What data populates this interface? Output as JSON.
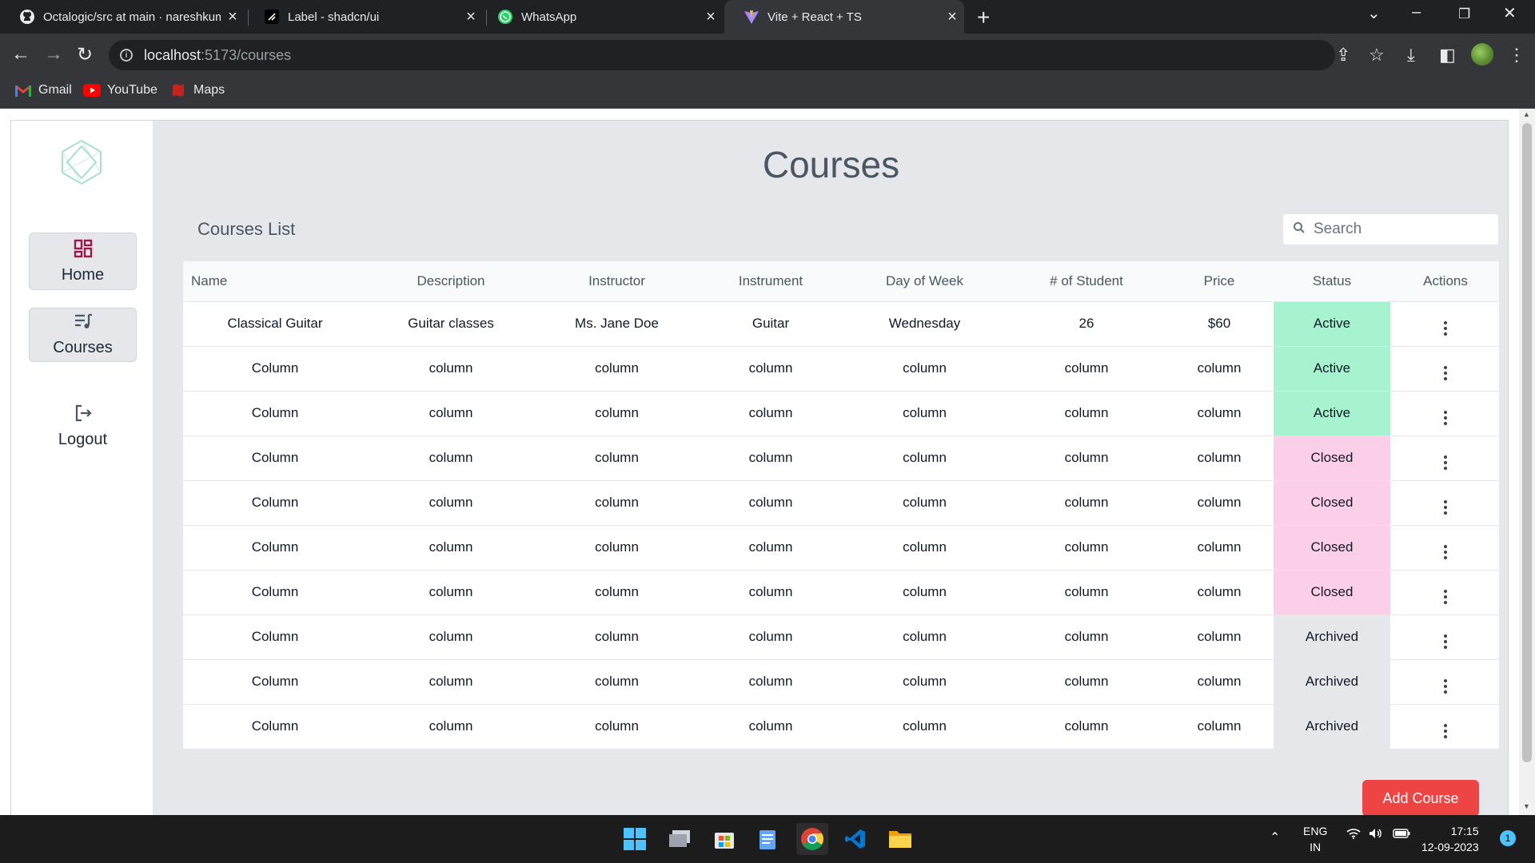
{
  "browser": {
    "tabs": [
      {
        "title": "Octalogic/src at main · nareshkum",
        "icon": "github-icon"
      },
      {
        "title": "Label - shadcn/ui",
        "icon": "shadcn-icon"
      },
      {
        "title": "WhatsApp",
        "icon": "whatsapp-icon"
      },
      {
        "title": "Vite + React + TS",
        "icon": "vite-icon",
        "active": true
      }
    ],
    "url_host": "localhost",
    "url_path": ":5173/courses",
    "bookmarks": [
      "Gmail",
      "YouTube",
      "Maps"
    ]
  },
  "sidebar": {
    "items": [
      {
        "label": "Home",
        "icon": "dashboard-icon",
        "color": "#9d174d"
      },
      {
        "label": "Courses",
        "icon": "playlist-icon"
      },
      {
        "label": "Logout",
        "icon": "logout-icon"
      }
    ]
  },
  "page": {
    "title": "Courses",
    "list_title": "Courses List",
    "search_placeholder": "Search"
  },
  "table": {
    "columns": [
      "Name",
      "Description",
      "Instructor",
      "Instrument",
      "Day of Week",
      "# of Student",
      "Price",
      "Status",
      "Actions"
    ],
    "rows": [
      {
        "name": "Classical Guitar",
        "description": "Guitar classes",
        "instructor": "Ms. Jane Doe",
        "instrument": "Guitar",
        "day": "Wednesday",
        "students": "26",
        "price": "$60",
        "status": "Active"
      },
      {
        "name": "Column",
        "description": "column",
        "instructor": "column",
        "instrument": "column",
        "day": "column",
        "students": "column",
        "price": "column",
        "status": "Active"
      },
      {
        "name": "Column",
        "description": "column",
        "instructor": "column",
        "instrument": "column",
        "day": "column",
        "students": "column",
        "price": "column",
        "status": "Active"
      },
      {
        "name": "Column",
        "description": "column",
        "instructor": "column",
        "instrument": "column",
        "day": "column",
        "students": "column",
        "price": "column",
        "status": "Closed"
      },
      {
        "name": "Column",
        "description": "column",
        "instructor": "column",
        "instrument": "column",
        "day": "column",
        "students": "column",
        "price": "column",
        "status": "Closed"
      },
      {
        "name": "Column",
        "description": "column",
        "instructor": "column",
        "instrument": "column",
        "day": "column",
        "students": "column",
        "price": "column",
        "status": "Closed"
      },
      {
        "name": "Column",
        "description": "column",
        "instructor": "column",
        "instrument": "column",
        "day": "column",
        "students": "column",
        "price": "column",
        "status": "Closed"
      },
      {
        "name": "Column",
        "description": "column",
        "instructor": "column",
        "instrument": "column",
        "day": "column",
        "students": "column",
        "price": "column",
        "status": "Archived"
      },
      {
        "name": "Column",
        "description": "column",
        "instructor": "column",
        "instrument": "column",
        "day": "column",
        "students": "column",
        "price": "column",
        "status": "Archived"
      },
      {
        "name": "Column",
        "description": "column",
        "instructor": "column",
        "instrument": "column",
        "day": "column",
        "students": "column",
        "price": "column",
        "status": "Archived"
      }
    ],
    "status_colors": {
      "Active": "#a7f3d0",
      "Closed": "#fbcfe8",
      "Archived": "#e5e7eb"
    }
  },
  "actions": {
    "add_course": "Add Course"
  },
  "accent_color": "#ef4444",
  "taskbar": {
    "lang": "ENG",
    "region": "IN",
    "time": "17:15",
    "date": "12-09-2023",
    "notifications": "1"
  }
}
